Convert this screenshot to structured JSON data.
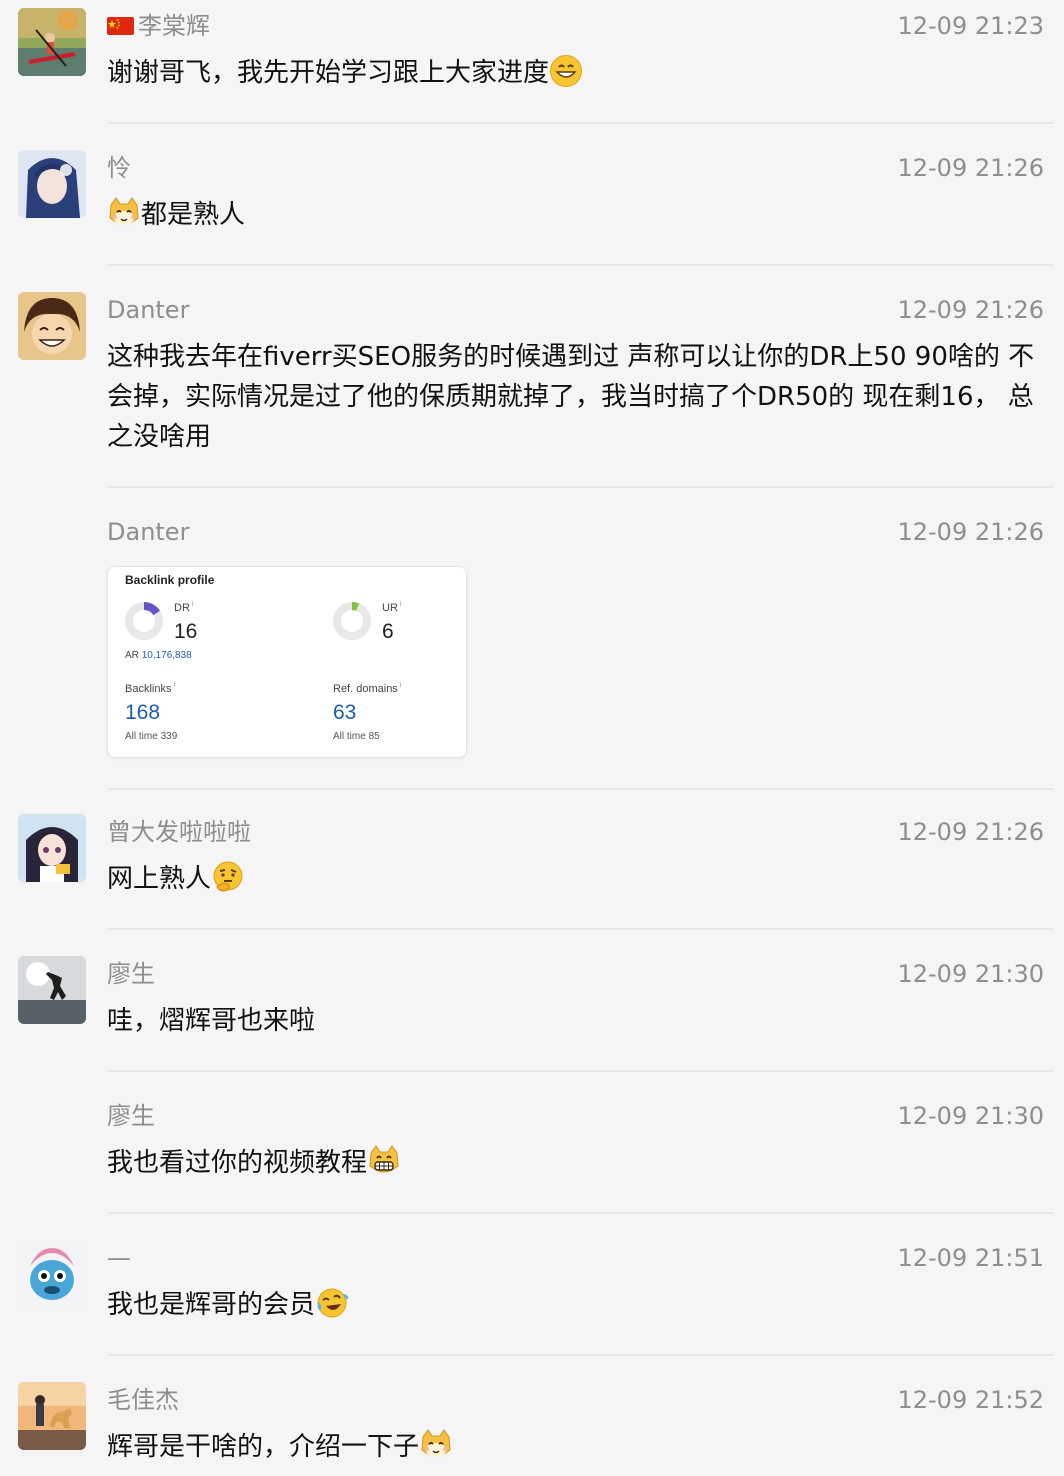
{
  "messages": [
    {
      "name": "李棠辉",
      "time": "12-09 21:23",
      "text": "谢谢哥飞，我先开始学习跟上大家进度",
      "emoji": "grinning-face-emoji",
      "has_flag": true
    },
    {
      "name": "怜",
      "time": "12-09 21:26",
      "text": "都是熟人",
      "emoji_lead": "cat-face-emoji"
    },
    {
      "name": "Danter",
      "time": "12-09 21:26",
      "text": "这种我去年在fiverr买SEO服务的时候遇到过 声称可以让你的DR上50 90啥的 不会掉，实际情况是过了他的保质期就掉了，我当时搞了个DR50的  现在剩16， 总之没啥用"
    },
    {
      "name": "Danter",
      "time": "12-09 21:26"
    },
    {
      "name": "曾大发啦啦啦",
      "time": "12-09 21:26",
      "text": "网上熟人",
      "emoji": "thinking-face-emoji"
    },
    {
      "name": "廖生",
      "time": "12-09 21:30",
      "text": "哇，熠辉哥也来啦"
    },
    {
      "name": "廖生",
      "time": "12-09 21:30",
      "text": "我也看过你的视频教程",
      "emoji": "grinning-cat-emoji"
    },
    {
      "name": "—",
      "time": "12-09 21:51",
      "text": "我也是辉哥的会员",
      "emoji": "crying-laughing-emoji"
    },
    {
      "name": "毛佳杰",
      "time": "12-09 21:52",
      "text": "辉哥是干啥的，介绍一下子",
      "emoji": "cat-face-emoji"
    }
  ],
  "backlink_card": {
    "title": "Backlink profile",
    "dr_label": "DR",
    "dr_value": "16",
    "dr_fill_fraction": 0.16,
    "ur_label": "UR",
    "ur_value": "6",
    "ur_fill_fraction": 0.06,
    "info_mark": "i",
    "ar_label": "AR",
    "ar_value": "10,176,838",
    "backlinks_label": "Backlinks",
    "backlinks_value": "168",
    "backlinks_alltime_label": "All time",
    "backlinks_alltime_value": "339",
    "refdomains_label": "Ref. domains",
    "refdomains_value": "63",
    "refdomains_alltime_label": "All time",
    "refdomains_alltime_value": "85"
  },
  "colors": {
    "background": "#f5f5f5",
    "meta_text": "#8e8e8e",
    "link_blue": "#1d5db0",
    "dr_purple": "#6a52c9",
    "ur_green": "#7cc43c"
  }
}
